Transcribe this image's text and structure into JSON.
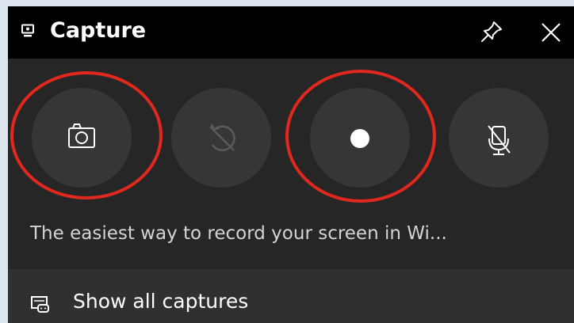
{
  "header": {
    "title": "Capture",
    "title_icon": "webcam-icon",
    "pin_icon": "pin-icon",
    "close_icon": "close-icon"
  },
  "buttons": [
    {
      "name": "screenshot",
      "icon": "camera-icon",
      "enabled": true,
      "highlighted": true
    },
    {
      "name": "record-last-30-seconds",
      "icon": "replay-disabled-icon",
      "enabled": false,
      "highlighted": false
    },
    {
      "name": "start-recording",
      "icon": "record-dot-icon",
      "enabled": true,
      "highlighted": true
    },
    {
      "name": "microphone",
      "icon": "mic-off-icon",
      "enabled": true,
      "highlighted": false
    }
  ],
  "hint_text": "The easiest way to record your screen in Wi...",
  "footer": {
    "label": "Show all captures",
    "icon": "gallery-icon"
  },
  "colors": {
    "highlight_ring": "#e0281f",
    "panel_background": "#262626",
    "title_background": "#000000",
    "page_background": "#dde6ee"
  }
}
